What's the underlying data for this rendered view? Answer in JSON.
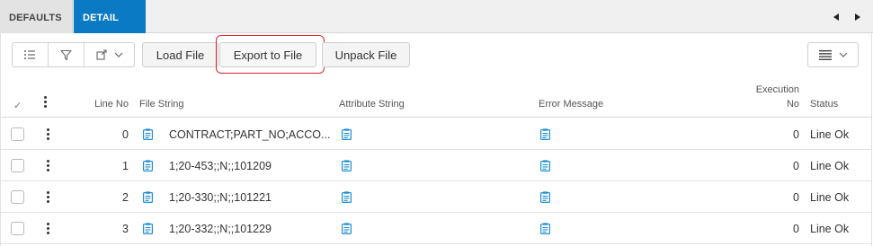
{
  "tabs": [
    {
      "label": "DEFAULTS",
      "active": false
    },
    {
      "label": "DETAIL",
      "active": true
    }
  ],
  "toolbar": {
    "load_label": "Load File",
    "export_label": "Export to File",
    "unpack_label": "Unpack File",
    "icons": [
      "list-icon",
      "filter-icon",
      "export-icon",
      "chevron-down-icon",
      "table-settings-icon"
    ]
  },
  "table": {
    "headers": {
      "check": "✓",
      "line_no": "Line No",
      "file_string": "File String",
      "attribute_string": "Attribute String",
      "error_message": "Error Message",
      "execution_no_1": "Execution",
      "execution_no_2": "No",
      "status": "Status"
    },
    "rows": [
      {
        "line_no": "0",
        "file_string": "CONTRACT;PART_NO;ACCO...",
        "execution_no": "0",
        "status": "Line Ok"
      },
      {
        "line_no": "1",
        "file_string": "1;20-453;;N;;101209",
        "execution_no": "0",
        "status": "Line Ok"
      },
      {
        "line_no": "2",
        "file_string": "1;20-330;;N;;101221",
        "execution_no": "0",
        "status": "Line Ok"
      },
      {
        "line_no": "3",
        "file_string": "1;20-332;;N;;101229",
        "execution_no": "0",
        "status": "Line Ok"
      }
    ]
  },
  "colors": {
    "active_tab": "#0b7ac4",
    "highlight": "#d8232a",
    "doc_icon": "#1e8fd4"
  }
}
